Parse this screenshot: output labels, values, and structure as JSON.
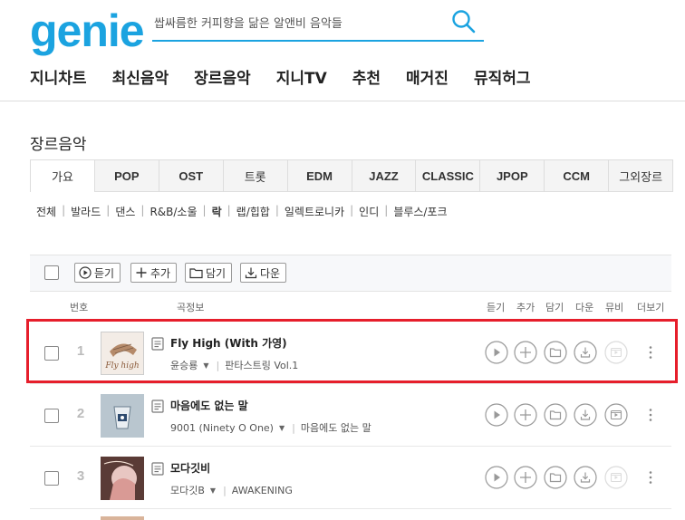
{
  "header": {
    "logo": "genie",
    "search_placeholder": "쌉싸름한 커피향을 닮은 알앤비 음악들",
    "search_icon": "search-icon"
  },
  "gnb": [
    "지니차트",
    "최신음악",
    "장르음악",
    "지니TV",
    "추천",
    "매거진",
    "뮤직허그"
  ],
  "section_title": "장르음악",
  "genre_tabs": [
    {
      "label": "가요",
      "active": true
    },
    {
      "label": "POP"
    },
    {
      "label": "OST"
    },
    {
      "label": "트롯"
    },
    {
      "label": "EDM"
    },
    {
      "label": "JAZZ"
    },
    {
      "label": "CLASSIC"
    },
    {
      "label": "JPOP"
    },
    {
      "label": "CCM"
    },
    {
      "label": "그외장르"
    }
  ],
  "sub_genres": [
    {
      "label": "전체"
    },
    {
      "label": "발라드"
    },
    {
      "label": "댄스"
    },
    {
      "label": "R&B/소울"
    },
    {
      "label": "락",
      "active": true
    },
    {
      "label": "랩/힙합"
    },
    {
      "label": "일렉트로니카"
    },
    {
      "label": "인디"
    },
    {
      "label": "블루스/포크"
    }
  ],
  "toolbar": {
    "listen": "듣기",
    "add": "추가",
    "save": "담기",
    "download": "다운"
  },
  "columns": {
    "number": "번호",
    "info": "곡정보",
    "listen": "듣기",
    "add": "추가",
    "save": "담기",
    "download": "다운",
    "mv": "뮤비",
    "more": "더보기"
  },
  "songs": [
    {
      "rank": "1",
      "title": "Fly High (With 가영)",
      "artist": "윤승룡",
      "album": "판타스트링 Vol.1",
      "has_mv": false,
      "selected": true,
      "cover_text": "Fly high"
    },
    {
      "rank": "2",
      "title": "마음에도 없는 말",
      "artist": "9001 (Ninety O One)",
      "album": "마음에도 없는 말",
      "has_mv": true
    },
    {
      "rank": "3",
      "title": "모다깃비",
      "artist": "모다깃B",
      "album": "AWAKENING",
      "has_mv": false
    }
  ],
  "colors": {
    "brand": "#1ba3e0",
    "highlight": "#e61e2b"
  }
}
